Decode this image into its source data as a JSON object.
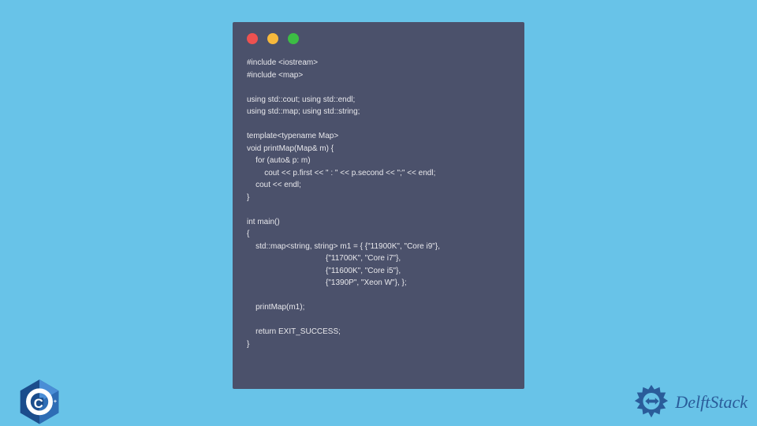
{
  "code": {
    "lines": [
      "#include <iostream>",
      "#include <map>",
      "",
      "using std::cout; using std::endl;",
      "using std::map; using std::string;",
      "",
      "template<typename Map>",
      "void printMap(Map& m) {",
      "    for (auto& p: m)",
      "        cout << p.first << \" : \" << p.second << \";\" << endl;",
      "    cout << endl;",
      "}",
      "",
      "int main()",
      "{",
      "    std::map<string, string> m1 = { {\"11900K\", \"Core i9\"},",
      "                                    {\"11700K\", \"Core i7\"},",
      "                                    {\"11600K\", \"Core i5\"},",
      "                                    {\"1390P\", \"Xeon W\"}, };",
      "",
      "    printMap(m1);",
      "",
      "    return EXIT_SUCCESS;",
      "}"
    ]
  },
  "cpp_label": "C++",
  "brand": "DelftStack"
}
